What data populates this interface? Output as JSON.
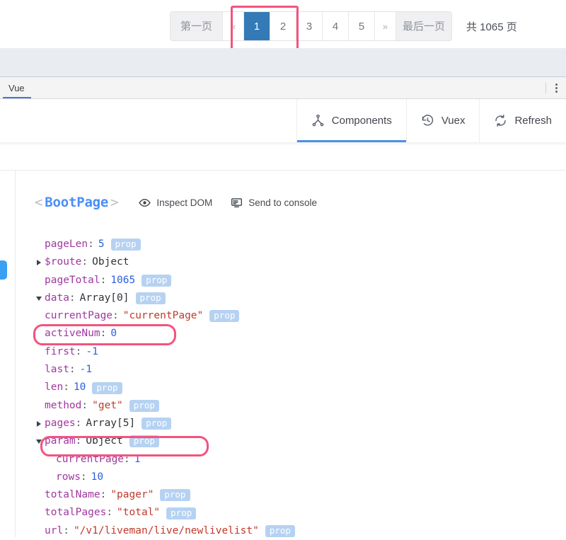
{
  "pagination": {
    "first_label": "第一页",
    "prev_label": "«",
    "next_label": "»",
    "last_label": "最后一页",
    "total_label": "共 1065 页",
    "pages": [
      "1",
      "2",
      "3",
      "4",
      "5"
    ],
    "active_page": "1",
    "active_color": "#337ab7"
  },
  "devtools": {
    "tabs": [
      {
        "label": "Vue",
        "active": true
      }
    ],
    "kebab_icon": "more-vertical-icon"
  },
  "vue_nav": {
    "items": [
      {
        "label": "Components",
        "icon": "component-tree-icon",
        "active": true
      },
      {
        "label": "Vuex",
        "icon": "history-clock-icon",
        "active": false
      },
      {
        "label": "Refresh",
        "icon": "refresh-icon",
        "active": false
      }
    ]
  },
  "inspector": {
    "open_angle": "<",
    "close_angle": ">",
    "component_name": "BootPage",
    "actions": [
      {
        "label": "Inspect DOM",
        "icon": "eye-icon"
      },
      {
        "label": "Send to console",
        "icon": "console-icon"
      }
    ],
    "badge_label": "prop",
    "properties": [
      {
        "toggle": "none",
        "indent": 0,
        "key": "pageLen",
        "value": "5",
        "type": "num",
        "prop": true
      },
      {
        "toggle": "collapsed",
        "indent": 0,
        "key": "$route",
        "value": "Object",
        "type": "obj",
        "prop": false
      },
      {
        "toggle": "none",
        "indent": 0,
        "key": "pageTotal",
        "value": "1065",
        "type": "num",
        "prop": true
      },
      {
        "toggle": "expanded",
        "indent": 0,
        "key": "data",
        "value": "Array[0]",
        "type": "obj",
        "prop": true
      },
      {
        "toggle": "none",
        "indent": 0,
        "key": "currentPage",
        "value": "\"currentPage\"",
        "type": "str",
        "prop": true
      },
      {
        "toggle": "none",
        "indent": 0,
        "key": "activeNum",
        "value": "0",
        "type": "num",
        "prop": false,
        "highlight": true
      },
      {
        "toggle": "none",
        "indent": 0,
        "key": "first",
        "value": "-1",
        "type": "num",
        "prop": false
      },
      {
        "toggle": "none",
        "indent": 0,
        "key": "last",
        "value": "-1",
        "type": "num",
        "prop": false
      },
      {
        "toggle": "none",
        "indent": 0,
        "key": "len",
        "value": "10",
        "type": "num",
        "prop": true
      },
      {
        "toggle": "none",
        "indent": 0,
        "key": "method",
        "value": "\"get\"",
        "type": "str",
        "prop": true
      },
      {
        "toggle": "collapsed",
        "indent": 0,
        "key": "pages",
        "value": "Array[5]",
        "type": "obj",
        "prop": true
      },
      {
        "toggle": "expanded",
        "indent": 0,
        "key": "param",
        "value": "Object",
        "type": "obj",
        "prop": true
      },
      {
        "toggle": "none",
        "indent": 1,
        "key": "currentPage",
        "value": "1",
        "type": "num",
        "prop": false,
        "highlight": true
      },
      {
        "toggle": "none",
        "indent": 1,
        "key": "rows",
        "value": "10",
        "type": "num",
        "prop": false
      },
      {
        "toggle": "none",
        "indent": 0,
        "key": "totalName",
        "value": "\"pager\"",
        "type": "str",
        "prop": true
      },
      {
        "toggle": "none",
        "indent": 0,
        "key": "totalPages",
        "value": "\"total\"",
        "type": "str",
        "prop": true
      },
      {
        "toggle": "none",
        "indent": 0,
        "key": "url",
        "value": "\"/v1/liveman/live/newlivelist\"",
        "type": "str",
        "prop": true
      }
    ]
  },
  "annotations": {
    "color": "#f4537f",
    "highlighted": [
      "pagination-page-1",
      "activeNum",
      "param.currentPage"
    ]
  }
}
